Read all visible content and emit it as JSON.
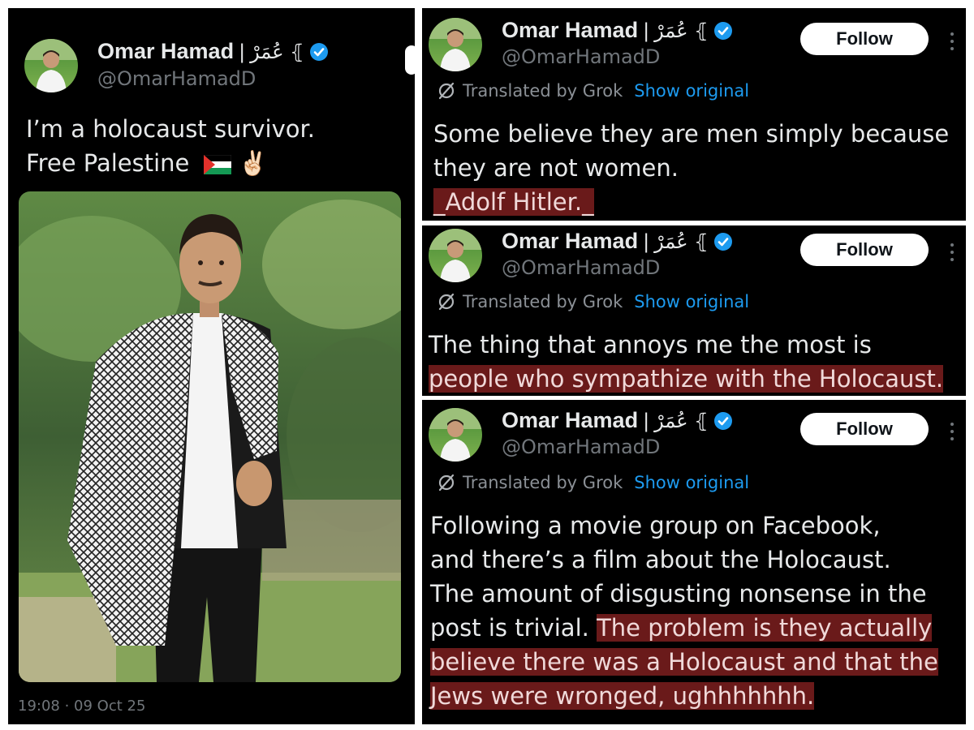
{
  "user": {
    "name": "Omar Hamad",
    "separator": "|",
    "name_arabic": "عُمَرْ ⦃",
    "handle": "@OmarHamadD"
  },
  "left_post": {
    "line1": "I’m a holocaust survivor.",
    "line2": "Free Palestine",
    "emoji_victory": "✌🏻",
    "timestamp": "19:08 · 09 Oct 25"
  },
  "follow_label": "Follow",
  "translated_label": "Translated by Grok",
  "show_original_label": "Show original",
  "posts": [
    {
      "line1": "Some believe they are men simply because",
      "line2": "they are not women.",
      "highlight": "_Adolf Hitler._"
    },
    {
      "line1": "The thing that annoys me the most is",
      "highlight": "people who sympathize with the Holocaust."
    },
    {
      "line1": "Following a movie group on Facebook,",
      "line2": "and there’s a film about the Holocaust.",
      "line3": "The amount of disgusting nonsense in the",
      "line4_plain": "post is trivial.",
      "line4_highlight": "The problem is they actually",
      "line5_highlight": "believe there was a Holocaust and that the",
      "line6_highlight": "Jews were wronged, ughhhhhhh."
    }
  ],
  "colors": {
    "background": "#000000",
    "text": "#e7e9ea",
    "muted": "#71767b",
    "link": "#1d9bf0",
    "verified": "#1d9bf0",
    "highlight": "#6a1a1a"
  },
  "icons": [
    "verified-badge-icon",
    "grok-translate-icon",
    "more-options-icon",
    "palestine-flag-icon"
  ]
}
